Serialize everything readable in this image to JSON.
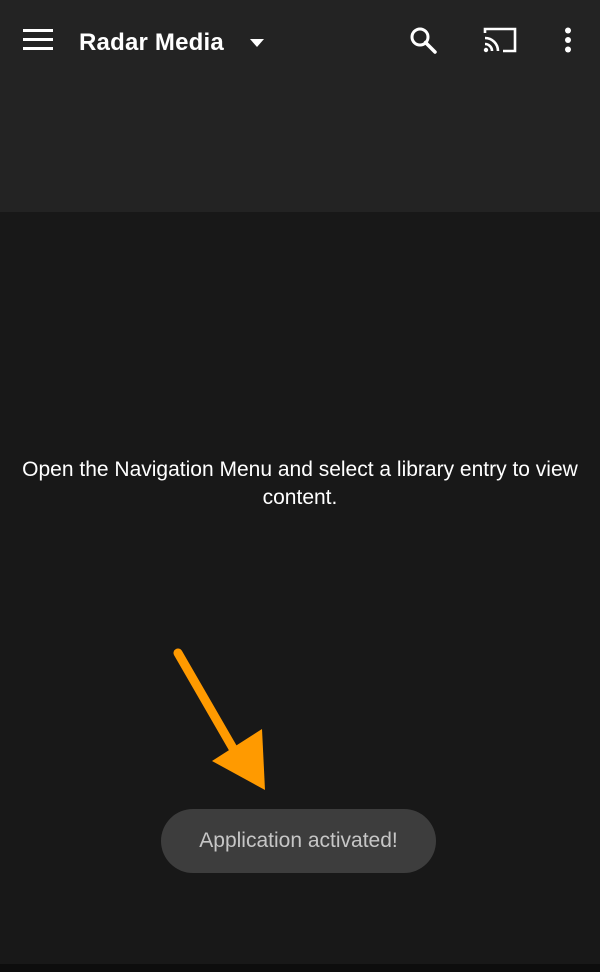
{
  "app_bar": {
    "title": "Radar Media",
    "icons": {
      "menu": "hamburger-menu-icon",
      "dropdown": "caret-down-icon",
      "search": "search-icon",
      "cast": "cast-icon",
      "overflow": "more-vert-icon"
    }
  },
  "main": {
    "empty_message": "Open the Navigation Menu and select a library entry to view content."
  },
  "toast": {
    "text": "Application activated!"
  },
  "annotation": {
    "arrow_color": "#FF9A00"
  },
  "colors": {
    "app_bar_background": "#232323",
    "content_background": "#181818",
    "toast_background": "#3D3D3D"
  }
}
